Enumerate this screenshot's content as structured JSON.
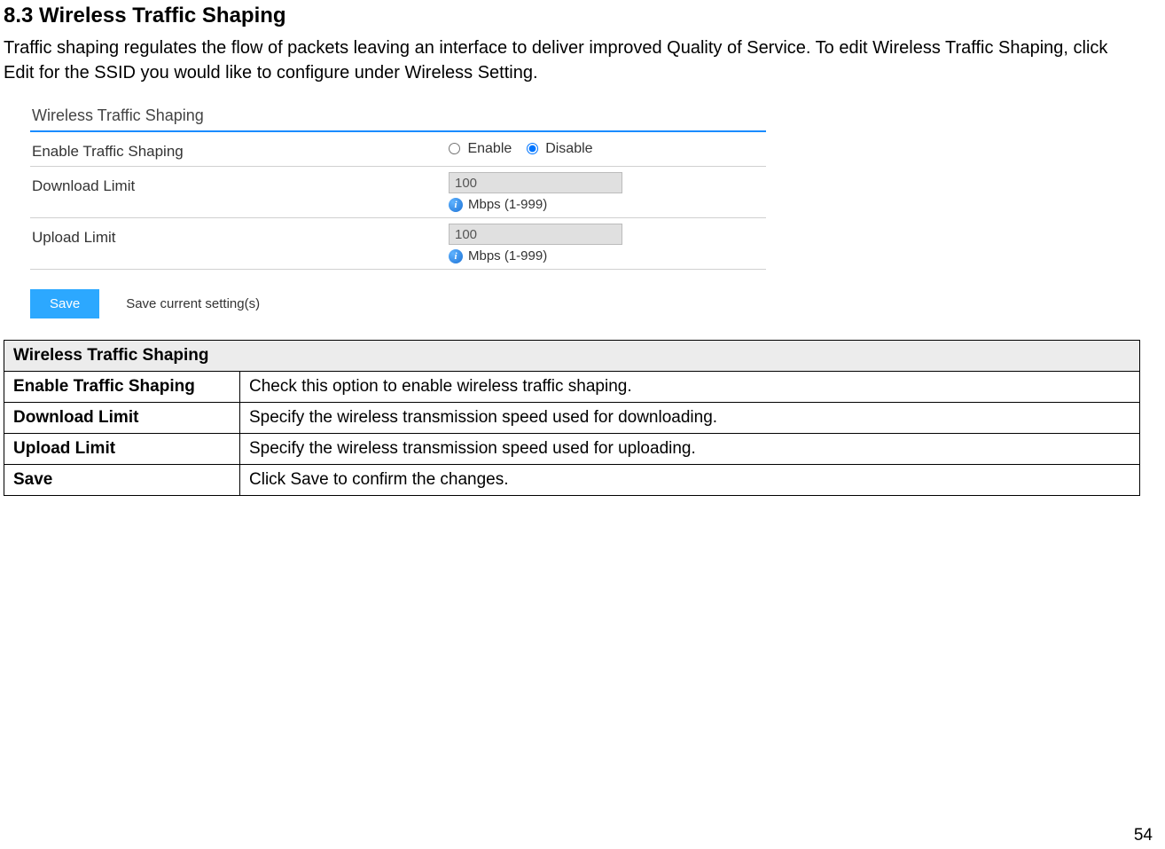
{
  "heading": "8.3   Wireless Traffic Shaping",
  "intro": "Traffic shaping regulates the flow of packets leaving an interface to deliver improved Quality of Service. To edit Wireless Traffic Shaping, click Edit for the SSID you would like to configure under Wireless Setting.",
  "screenshot": {
    "title": "Wireless Traffic Shaping",
    "enable_label": "Enable Traffic Shaping",
    "enable_opt1": "Enable",
    "enable_opt2": "Disable",
    "download_label": "Download Limit",
    "download_value": "100",
    "download_hint": "Mbps (1-999)",
    "upload_label": "Upload Limit",
    "upload_value": "100",
    "upload_hint": "Mbps (1-999)",
    "save_btn": "Save",
    "save_desc": "Save current setting(s)"
  },
  "table": {
    "header": "Wireless Traffic Shaping",
    "rows": [
      {
        "label": "Enable Traffic Shaping",
        "desc": "Check this option to enable wireless traffic shaping."
      },
      {
        "label": "Download Limit",
        "desc": "Specify the wireless transmission speed used for downloading."
      },
      {
        "label": "Upload Limit",
        "desc": "Specify the wireless transmission speed used for uploading."
      },
      {
        "label": "Save",
        "desc": "Click Save to confirm the changes."
      }
    ]
  },
  "page_number": "54"
}
